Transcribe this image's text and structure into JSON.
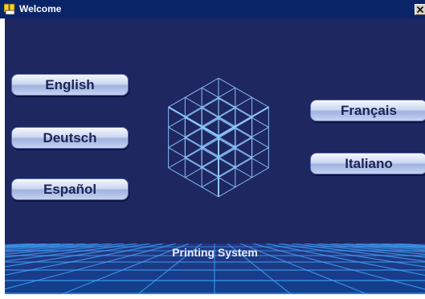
{
  "window": {
    "title": "Welcome",
    "icons": {
      "app": "book-app-icon",
      "close": "close-icon"
    }
  },
  "languages": [
    {
      "label": "English"
    },
    {
      "label": "Deutsch"
    },
    {
      "label": "Español"
    },
    {
      "label": "Français"
    },
    {
      "label": "Italiano"
    }
  ],
  "product_title": "Printing System",
  "graphic": {
    "name": "wireframe-cube",
    "color": "#8fc8ff"
  },
  "colors": {
    "titlebar": "#0a2468",
    "background": "#1e2760",
    "button_text": "#1c2456",
    "grid": "#3fa8ff"
  }
}
